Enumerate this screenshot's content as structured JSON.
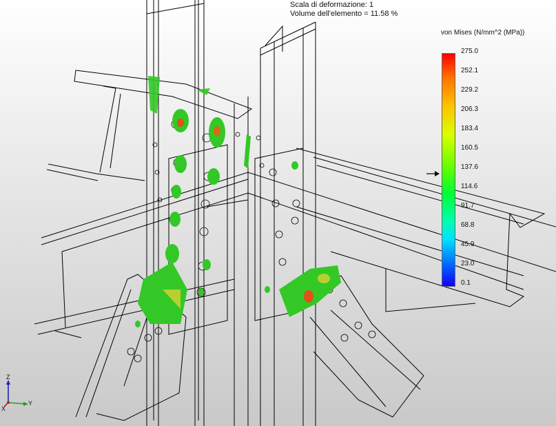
{
  "info": {
    "line1": "Scala di deformazione: 1",
    "line2": "Volume dell'elemento = 11.58 %"
  },
  "legend": {
    "title": "von Mises (N/mm^2 (MPa))",
    "ticks": [
      "275.0",
      "252.1",
      "229.2",
      "206.3",
      "183.4",
      "160.5",
      "137.6",
      "114.6",
      "91.7",
      "68.8",
      "45.9",
      "23.0",
      "0.1"
    ],
    "indicator_value": 137.6
  },
  "triad": {
    "z": "Z",
    "x": "X",
    "y": "Y"
  },
  "colors": {
    "stress_high": "#ff2000",
    "stress_mid": "#2cd628",
    "edge": "#000000"
  }
}
